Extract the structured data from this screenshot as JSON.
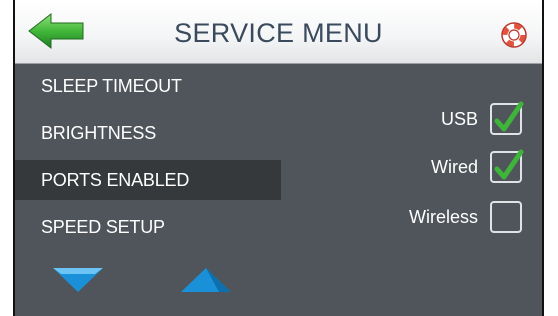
{
  "header": {
    "title": "SERVICE MENU",
    "back_icon": "back-arrow-icon",
    "help_icon": "lifebuoy-icon"
  },
  "menu": {
    "items": [
      {
        "label": "SLEEP TIMEOUT",
        "active": false
      },
      {
        "label": "BRIGHTNESS",
        "active": false
      },
      {
        "label": "PORTS ENABLED",
        "active": true
      },
      {
        "label": "SPEED SETUP",
        "active": false
      }
    ],
    "scroll_down_icon": "chevron-down-icon",
    "scroll_up_icon": "chevron-up-icon"
  },
  "ports": {
    "options": [
      {
        "label": "USB",
        "checked": true
      },
      {
        "label": "Wired",
        "checked": true
      },
      {
        "label": "Wireless",
        "checked": false
      }
    ]
  },
  "colors": {
    "panel": "#4f555a",
    "active_row": "#36393c",
    "check_green": "#3fb43a",
    "arrow_blue": "#1a90d8",
    "back_green": "#38b23a"
  }
}
